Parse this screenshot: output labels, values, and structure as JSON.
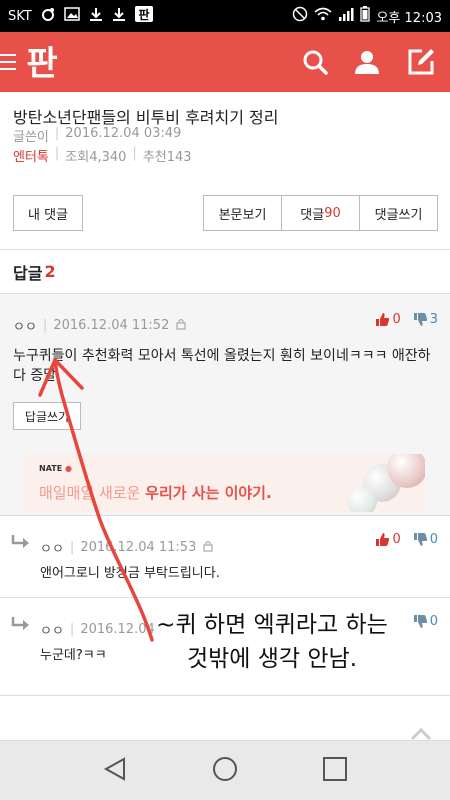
{
  "status_bar": {
    "carrier": "SKT",
    "time": "오후 12:03"
  },
  "app": {
    "logo_text": "판",
    "accent": "#e8504a"
  },
  "article": {
    "title": "방탄소년단팬들의 비투비 후려치기 정리",
    "author_label": "글쓴이",
    "datetime": "2016.12.04 03:49",
    "category": "엔터톡",
    "views": "조회4,340",
    "recommends": "추천143"
  },
  "buttons": {
    "my_comments": "내 댓글",
    "view_post": "본문보기",
    "comments_label": "댓글",
    "comments_count": "90",
    "write_comment": "댓글쓰기"
  },
  "replies_header": {
    "label": "답글",
    "count": "2"
  },
  "comments": [
    {
      "author": "ㅇㅇ",
      "datetime": "2016.12.04 11:52",
      "body": "누구퀴들이 추천화력 모아서 톡선에 올렸는지 훤히 보이네ㅋㅋㅋ 애잔하다 증말",
      "up": "0",
      "down": "3",
      "reply_button": "답글쓰기"
    }
  ],
  "ad": {
    "brand": "NATE",
    "text_light": "매일매일 새로운 ",
    "text_strong": "우리가 사는 이야기."
  },
  "sub_comments": [
    {
      "author": "ㅇㅇ",
      "datetime": "2016.12.04 11:53",
      "body": "앤어그로니 방청금 부탁드립니다.",
      "up": "0",
      "down": "0"
    },
    {
      "author": "ㅇㅇ",
      "datetime": "2016.12.04",
      "body": "누군데?ㅋㅋ",
      "up": "",
      "down": "0"
    }
  ],
  "overlay_caption": {
    "line1": "~퀴 하면 엑퀴라고 하는",
    "line2": "것밖에 생각 안남."
  }
}
